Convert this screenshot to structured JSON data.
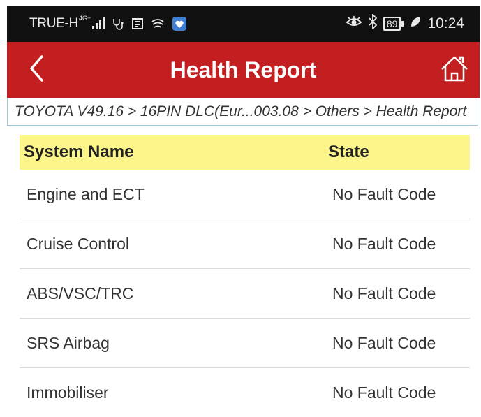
{
  "statusbar": {
    "carrier": "TRUE-H",
    "network": "4G+",
    "battery": "89",
    "time": "10:24",
    "icons": [
      "signal-icon",
      "stethoscope-icon",
      "news-icon",
      "swipe-icon",
      "app-heart-icon",
      "eye-icon",
      "bluetooth-icon",
      "battery-icon",
      "leaf-icon"
    ]
  },
  "appbar": {
    "title": "Health Report",
    "back_icon": "chevron-left-icon",
    "home_icon": "home-icon",
    "color": "#c41f20"
  },
  "breadcrumb": "TOYOTA V49.16 > 16PIN DLC(Eur...003.08 > Others > Health Report",
  "table": {
    "headers": [
      "System Name",
      "State"
    ],
    "header_color": "#fbf58a",
    "rows": [
      {
        "system": "Engine and ECT",
        "state": "No Fault Code"
      },
      {
        "system": "Cruise Control",
        "state": "No Fault Code"
      },
      {
        "system": "ABS/VSC/TRC",
        "state": "No Fault Code"
      },
      {
        "system": "SRS Airbag",
        "state": "No Fault Code"
      },
      {
        "system": "Immobiliser",
        "state": "No Fault Code"
      }
    ]
  }
}
